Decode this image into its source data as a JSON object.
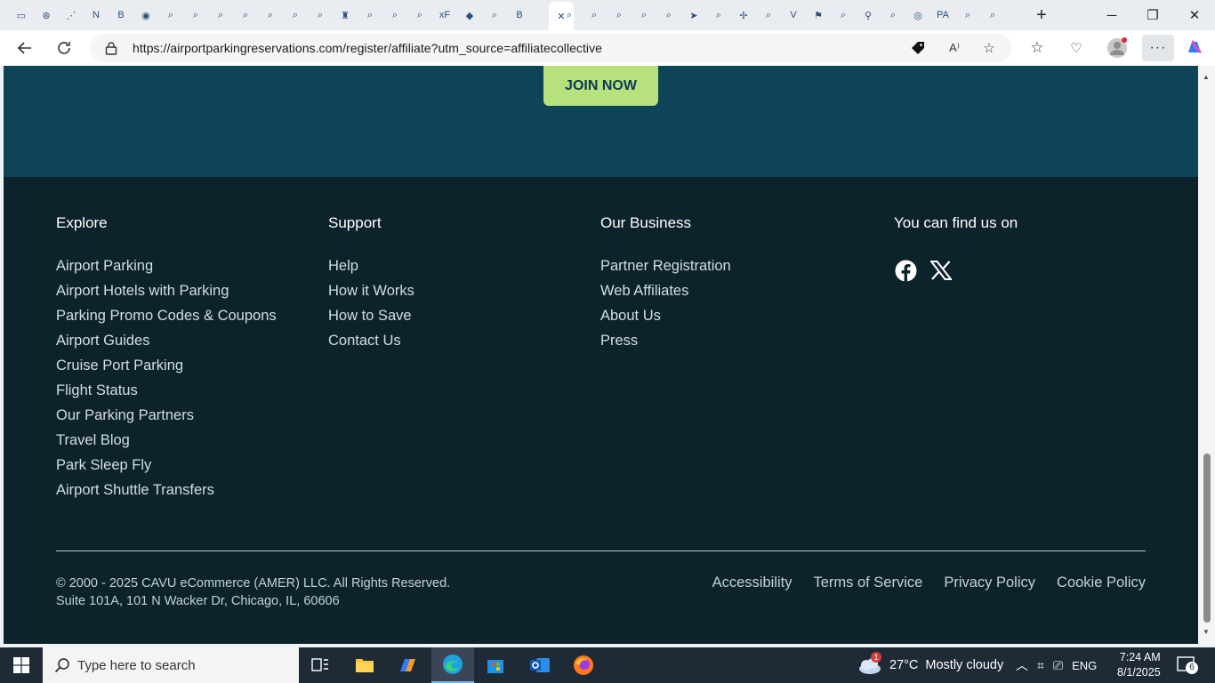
{
  "browser": {
    "tabs": [
      {
        "icon": "sidebar-icon",
        "glyph": "▭"
      },
      {
        "icon": "openai-icon",
        "glyph": "⊛"
      },
      {
        "icon": "chart-icon",
        "glyph": "⋰"
      },
      {
        "icon": "notion-icon",
        "glyph": "N"
      },
      {
        "icon": "b-icon",
        "glyph": "B"
      },
      {
        "icon": "maps-icon",
        "glyph": "◉"
      },
      {
        "icon": "search-icon",
        "glyph": "⌕"
      },
      {
        "icon": "search-icon",
        "glyph": "⌕"
      },
      {
        "icon": "search-icon",
        "glyph": "⌕"
      },
      {
        "icon": "search-icon",
        "glyph": "⌕"
      },
      {
        "icon": "search-icon",
        "glyph": "⌕"
      },
      {
        "icon": "search-icon",
        "glyph": "⌕"
      },
      {
        "icon": "search-icon",
        "glyph": "⌕"
      },
      {
        "icon": "castle-icon",
        "glyph": "♜"
      },
      {
        "icon": "search-icon",
        "glyph": "⌕"
      },
      {
        "icon": "search-icon",
        "glyph": "⌕"
      },
      {
        "icon": "search-icon",
        "glyph": "⌕"
      },
      {
        "icon": "xf-icon",
        "glyph": "xF"
      },
      {
        "icon": "layers-icon",
        "glyph": "◆"
      },
      {
        "icon": "search-icon",
        "glyph": "⌕"
      },
      {
        "icon": "b-icon",
        "glyph": "B"
      },
      {
        "icon": "close-tab-icon",
        "glyph": "✕"
      },
      {
        "icon": "search-icon",
        "glyph": "⌕"
      },
      {
        "icon": "search-icon",
        "glyph": "⌕"
      },
      {
        "icon": "search-icon",
        "glyph": "⌕"
      },
      {
        "icon": "search-icon",
        "glyph": "⌕"
      },
      {
        "icon": "search-icon",
        "glyph": "⌕"
      },
      {
        "icon": "send-icon",
        "glyph": "➤"
      },
      {
        "icon": "search-icon",
        "glyph": "⌕"
      },
      {
        "icon": "spark-icon",
        "glyph": "✢"
      },
      {
        "icon": "search-icon",
        "glyph": "⌕"
      },
      {
        "icon": "v-icon",
        "glyph": "V"
      },
      {
        "icon": "flag-icon",
        "glyph": "⚑"
      },
      {
        "icon": "search-icon",
        "glyph": "⌕"
      },
      {
        "icon": "pin-icon",
        "glyph": "⚲"
      },
      {
        "icon": "search-icon",
        "glyph": "⌕"
      },
      {
        "icon": "circle-icon",
        "glyph": "◎"
      },
      {
        "icon": "pa-icon",
        "glyph": "PA"
      },
      {
        "icon": "search-icon",
        "glyph": "⌕"
      },
      {
        "icon": "search-icon",
        "glyph": "⌕"
      }
    ],
    "new_tab_glyph": "+",
    "window": {
      "minimize": "─",
      "restore": "❐",
      "close": "✕"
    },
    "url": "https://airportparkingreservations.com/register/affiliate?utm_source=affiliatecollective"
  },
  "page": {
    "join_button": "JOIN NOW",
    "footer": {
      "explore": {
        "heading": "Explore",
        "links": [
          "Airport Parking",
          "Airport Hotels with Parking",
          "Parking Promo Codes & Coupons",
          "Airport Guides",
          "Cruise Port Parking",
          "Flight Status",
          "Our Parking Partners",
          "Travel Blog",
          "Park Sleep Fly",
          "Airport Shuttle Transfers"
        ]
      },
      "support": {
        "heading": "Support",
        "links": [
          "Help",
          "How it Works",
          "How to Save",
          "Contact Us"
        ]
      },
      "business": {
        "heading": "Our Business",
        "links": [
          "Partner Registration",
          "Web Affiliates",
          "About Us",
          "Press"
        ]
      },
      "social": {
        "heading": "You can find us on"
      },
      "copyright": "© 2000 - 2025 CAVU eCommerce (AMER) LLC. All Rights Reserved.",
      "address": "Suite 101A, 101 N Wacker Dr, Chicago, IL, 60606",
      "legal_links": [
        "Accessibility",
        "Terms of Service",
        "Privacy Policy",
        "Cookie Policy"
      ]
    }
  },
  "taskbar": {
    "search_placeholder": "Type here to search",
    "weather_temp": "27°C",
    "weather_text": "Mostly cloudy",
    "weather_badge": "1",
    "language": "ENG",
    "time": "7:24 AM",
    "date": "8/1/2025",
    "notification_count": "6"
  },
  "colors": {
    "hero_band": "#0e4458",
    "footer_bg": "#0d232c",
    "join_button_bg": "#b6e17c",
    "join_button_text": "#0f3a55"
  }
}
